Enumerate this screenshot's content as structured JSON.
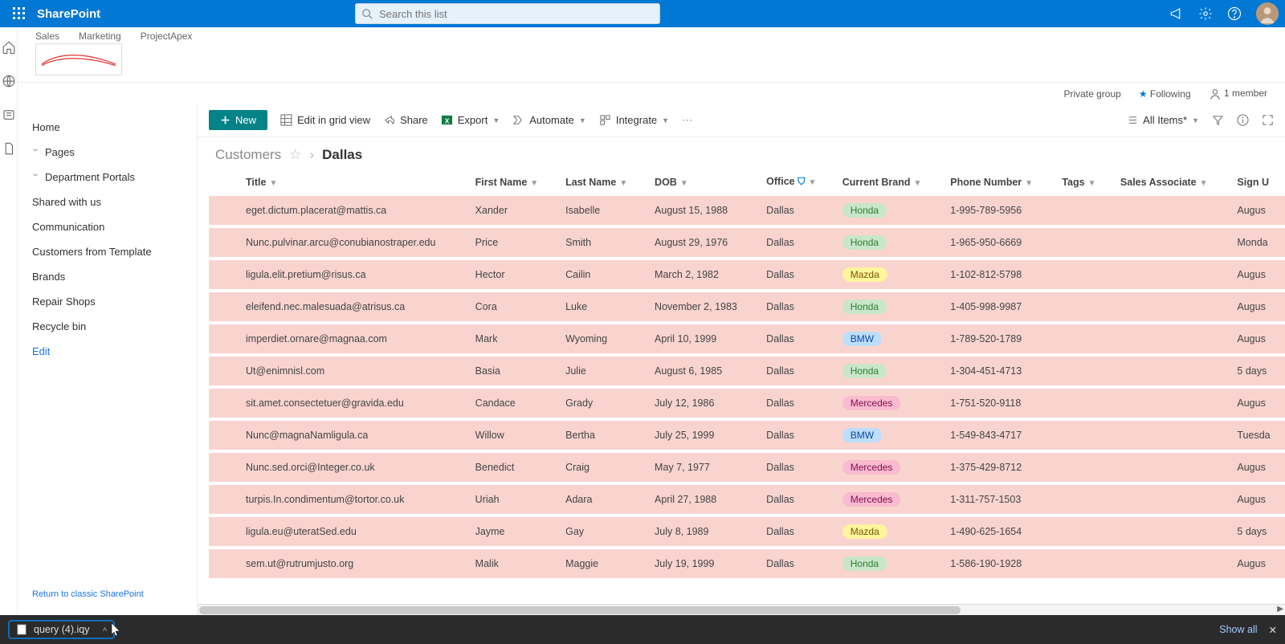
{
  "brand": "SharePoint",
  "search": {
    "placeholder": "Search this list"
  },
  "hubnav": [
    "Sales",
    "Marketing",
    "ProjectApex"
  ],
  "siteinfo": {
    "group": "Private group",
    "following": "Following",
    "members": "1 member"
  },
  "leftnav": {
    "home": "Home",
    "pages": "Pages",
    "dept": "Department Portals",
    "shared": "Shared with us",
    "comm": "Communication",
    "cft": "Customers from Template",
    "brands": "Brands",
    "repair": "Repair Shops",
    "recycle": "Recycle bin",
    "edit": "Edit",
    "return": "Return to classic SharePoint"
  },
  "commands": {
    "new": "New",
    "editgrid": "Edit in grid view",
    "share": "Share",
    "export": "Export",
    "automate": "Automate",
    "integrate": "Integrate",
    "allitems": "All Items*"
  },
  "breadcrumb": {
    "list": "Customers",
    "view": "Dallas"
  },
  "columns": {
    "title": "Title",
    "first": "First Name",
    "last": "Last Name",
    "dob": "DOB",
    "office": "Office",
    "brand": "Current Brand",
    "phone": "Phone Number",
    "tags": "Tags",
    "assoc": "Sales Associate",
    "sign": "Sign U"
  },
  "rows": [
    {
      "title": "eget.dictum.placerat@mattis.ca",
      "first": "Xander",
      "last": "Isabelle",
      "dob": "August 15, 1988",
      "office": "Dallas",
      "brand": "Honda",
      "phone": "1-995-789-5956",
      "sign": "Augus"
    },
    {
      "title": "Nunc.pulvinar.arcu@conubianostraper.edu",
      "first": "Price",
      "last": "Smith",
      "dob": "August 29, 1976",
      "office": "Dallas",
      "brand": "Honda",
      "phone": "1-965-950-6669",
      "sign": "Monda"
    },
    {
      "title": "ligula.elit.pretium@risus.ca",
      "first": "Hector",
      "last": "Cailin",
      "dob": "March 2, 1982",
      "office": "Dallas",
      "brand": "Mazda",
      "phone": "1-102-812-5798",
      "sign": "Augus"
    },
    {
      "title": "eleifend.nec.malesuada@atrisus.ca",
      "first": "Cora",
      "last": "Luke",
      "dob": "November 2, 1983",
      "office": "Dallas",
      "brand": "Honda",
      "phone": "1-405-998-9987",
      "sign": "Augus"
    },
    {
      "title": "imperdiet.ornare@magnaa.com",
      "first": "Mark",
      "last": "Wyoming",
      "dob": "April 10, 1999",
      "office": "Dallas",
      "brand": "BMW",
      "phone": "1-789-520-1789",
      "sign": "Augus"
    },
    {
      "title": "Ut@enimnisl.com",
      "first": "Basia",
      "last": "Julie",
      "dob": "August 6, 1985",
      "office": "Dallas",
      "brand": "Honda",
      "phone": "1-304-451-4713",
      "sign": "5 days"
    },
    {
      "title": "sit.amet.consectetuer@gravida.edu",
      "first": "Candace",
      "last": "Grady",
      "dob": "July 12, 1986",
      "office": "Dallas",
      "brand": "Mercedes",
      "phone": "1-751-520-9118",
      "sign": "Augus"
    },
    {
      "title": "Nunc@magnaNamligula.ca",
      "first": "Willow",
      "last": "Bertha",
      "dob": "July 25, 1999",
      "office": "Dallas",
      "brand": "BMW",
      "phone": "1-549-843-4717",
      "sign": "Tuesda"
    },
    {
      "title": "Nunc.sed.orci@Integer.co.uk",
      "first": "Benedict",
      "last": "Craig",
      "dob": "May 7, 1977",
      "office": "Dallas",
      "brand": "Mercedes",
      "phone": "1-375-429-8712",
      "sign": "Augus"
    },
    {
      "title": "turpis.In.condimentum@tortor.co.uk",
      "first": "Uriah",
      "last": "Adara",
      "dob": "April 27, 1988",
      "office": "Dallas",
      "brand": "Mercedes",
      "phone": "1-311-757-1503",
      "sign": "Augus"
    },
    {
      "title": "ligula.eu@uteratSed.edu",
      "first": "Jayme",
      "last": "Gay",
      "dob": "July 8, 1989",
      "office": "Dallas",
      "brand": "Mazda",
      "phone": "1-490-625-1654",
      "sign": "5 days"
    },
    {
      "title": "sem.ut@rutrumjusto.org",
      "first": "Malik",
      "last": "Maggie",
      "dob": "July 19, 1999",
      "office": "Dallas",
      "brand": "Honda",
      "phone": "1-586-190-1928",
      "sign": "Augus"
    }
  ],
  "download": {
    "filename": "query (4).iqy",
    "showall": "Show all"
  }
}
